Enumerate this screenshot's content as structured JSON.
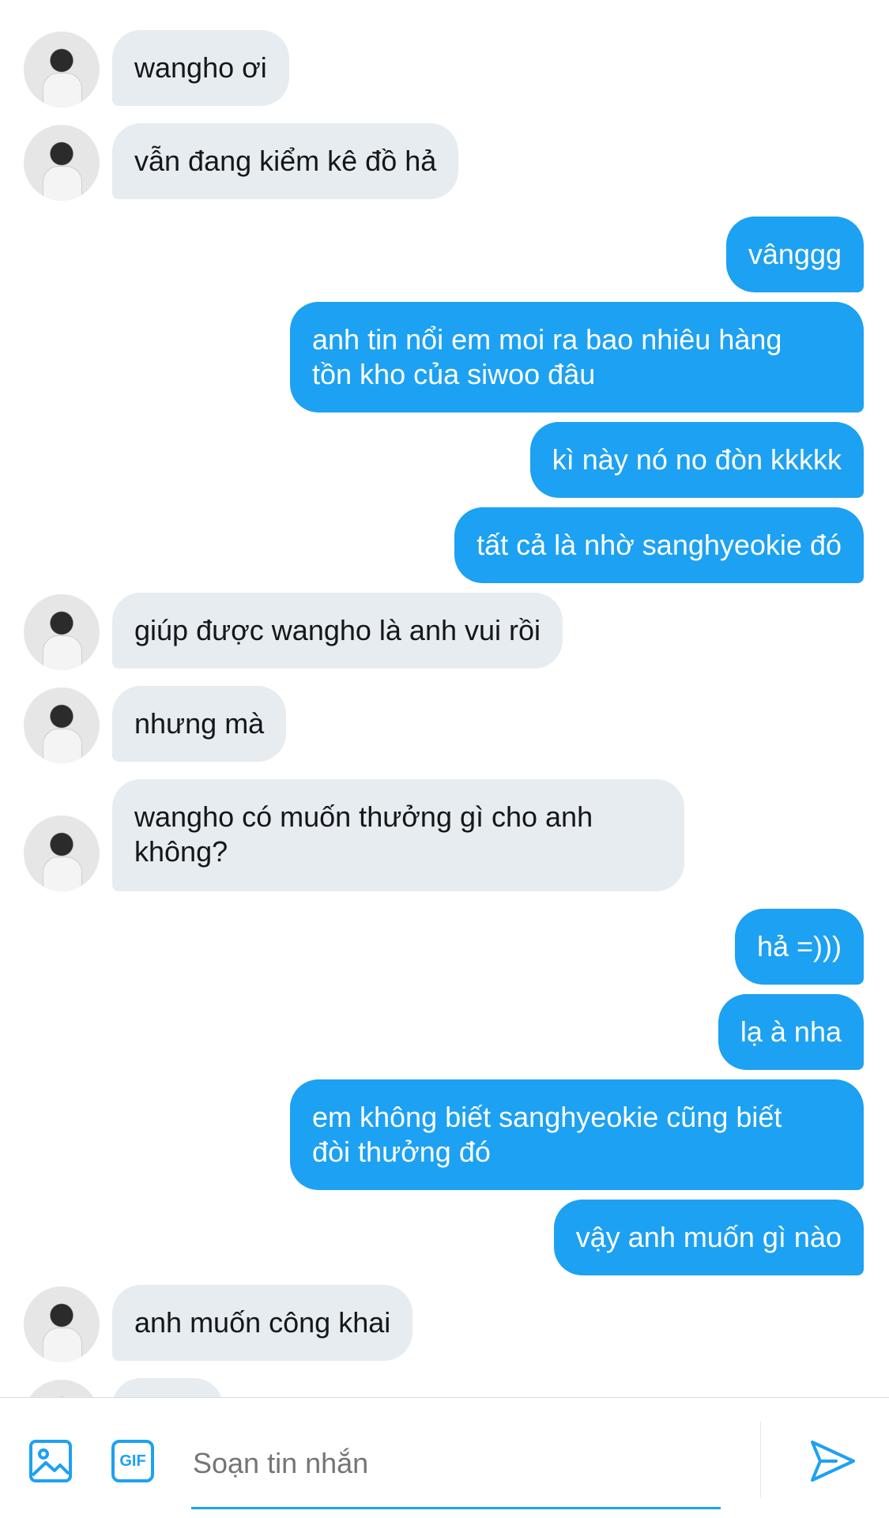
{
  "messages": [
    {
      "side": "in",
      "text": "wangho ơi"
    },
    {
      "side": "in",
      "text": "vẫn đang kiểm kê đồ hả"
    },
    {
      "side": "out",
      "text": "vânggg"
    },
    {
      "side": "out",
      "text": "anh tin nổi em moi ra bao nhiêu hàng\ntồn kho của siwoo đâu"
    },
    {
      "side": "out",
      "text": "kì này nó no đòn kkkkk"
    },
    {
      "side": "out",
      "text": "tất cả là nhờ sanghyeokie đó"
    },
    {
      "side": "in",
      "text": "giúp được wangho là anh vui rồi"
    },
    {
      "side": "in",
      "text": "nhưng mà"
    },
    {
      "side": "in",
      "text": "wangho có muốn thưởng gì cho anh\nkhông?"
    },
    {
      "side": "out",
      "text": "hả =)))"
    },
    {
      "side": "out",
      "text": "lạ à nha"
    },
    {
      "side": "out",
      "text": "em không biết sanghyeokie cũng biết\nđòi thưởng đó"
    },
    {
      "side": "out",
      "text": "vậy anh muốn gì nào"
    },
    {
      "side": "in",
      "text": "anh muốn công khai"
    }
  ],
  "composer": {
    "placeholder": "Soạn tin nhắn",
    "gif_label": "GIF"
  },
  "colors": {
    "accent": "#1da1f2",
    "incoming_bubble": "#e6ecf0"
  }
}
